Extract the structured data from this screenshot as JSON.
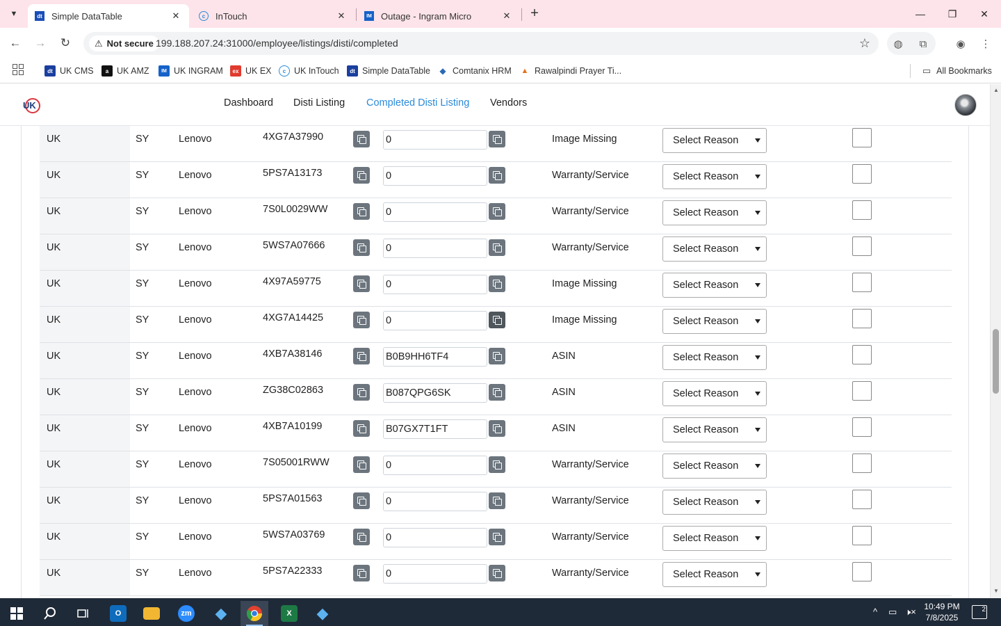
{
  "browser": {
    "tabs": [
      {
        "title": "Simple DataTable",
        "favicon": "dt-icon",
        "favicon_text": "dt",
        "color": "#1a4db8"
      },
      {
        "title": "InTouch",
        "favicon": "intouch-icon",
        "favicon_text": "c",
        "color": "#2a8ad8"
      },
      {
        "title": "Outage - Ingram Micro",
        "favicon": "ingram-icon",
        "favicon_text": "IM",
        "color": "#1562c9"
      }
    ],
    "new_tab": "+",
    "security_label": "Not secure",
    "url": "199.188.207.24:31000/employee/listings/disti/completed",
    "bookmarks": [
      {
        "label": "UK CMS",
        "icon_text": "dt",
        "color": "#1a3f9e"
      },
      {
        "label": "UK AMZ",
        "icon_text": "a",
        "color": "#111111"
      },
      {
        "label": "UK INGRAM",
        "icon_text": "IM",
        "color": "#1562c9"
      },
      {
        "label": "UK EX",
        "icon_text": "ex",
        "color": "#e03b2e"
      },
      {
        "label": "UK InTouch",
        "icon_text": "c",
        "color": "#2a8ad8"
      },
      {
        "label": "Simple DataTable",
        "icon_text": "dt",
        "color": "#1a3f9e"
      },
      {
        "label": "Comtanix HRM",
        "icon_text": "◆",
        "color": "#2c6ab3"
      },
      {
        "label": "Rawalpindi Prayer Ti...",
        "icon_text": "▲",
        "color": "#e5731c"
      }
    ],
    "all_bookmarks": "All Bookmarks"
  },
  "nav": {
    "links": [
      "Dashboard",
      "Disti Listing",
      "Completed Disti Listing",
      "Vendors"
    ],
    "active_index": 2,
    "accent_color": "#2a8ad8"
  },
  "table": {
    "rows": [
      {
        "country": "UK",
        "code": "SY",
        "brand": "Lenovo",
        "sku": "4XG7A37990",
        "value": "0",
        "note": "Image Missing",
        "reason": "Select Reason"
      },
      {
        "country": "UK",
        "code": "SY",
        "brand": "Lenovo",
        "sku": "5PS7A13173",
        "value": "0",
        "note": "Warranty/Service",
        "reason": "Select Reason"
      },
      {
        "country": "UK",
        "code": "SY",
        "brand": "Lenovo",
        "sku": "7S0L0029WW",
        "value": "0",
        "note": "Warranty/Service",
        "reason": "Select Reason"
      },
      {
        "country": "UK",
        "code": "SY",
        "brand": "Lenovo",
        "sku": "5WS7A07666",
        "value": "0",
        "note": "Warranty/Service",
        "reason": "Select Reason"
      },
      {
        "country": "UK",
        "code": "SY",
        "brand": "Lenovo",
        "sku": "4X97A59775",
        "value": "0",
        "note": "Image Missing",
        "reason": "Select Reason"
      },
      {
        "country": "UK",
        "code": "SY",
        "brand": "Lenovo",
        "sku": "4XG7A14425",
        "value": "0",
        "note": "Image Missing",
        "reason": "Select Reason"
      },
      {
        "country": "UK",
        "code": "SY",
        "brand": "Lenovo",
        "sku": "4XB7A38146",
        "value": "B0B9HH6TF4",
        "note": "ASIN",
        "reason": "Select Reason"
      },
      {
        "country": "UK",
        "code": "SY",
        "brand": "Lenovo",
        "sku": "ZG38C02863",
        "value": "B087QPG6SK",
        "note": "ASIN",
        "reason": "Select Reason"
      },
      {
        "country": "UK",
        "code": "SY",
        "brand": "Lenovo",
        "sku": "4XB7A10199",
        "value": "B07GX7T1FT",
        "note": "ASIN",
        "reason": "Select Reason"
      },
      {
        "country": "UK",
        "code": "SY",
        "brand": "Lenovo",
        "sku": "7S05001RWW",
        "value": "0",
        "note": "Warranty/Service",
        "reason": "Select Reason"
      },
      {
        "country": "UK",
        "code": "SY",
        "brand": "Lenovo",
        "sku": "5PS7A01563",
        "value": "0",
        "note": "Warranty/Service",
        "reason": "Select Reason"
      },
      {
        "country": "UK",
        "code": "SY",
        "brand": "Lenovo",
        "sku": "5WS7A03769",
        "value": "0",
        "note": "Warranty/Service",
        "reason": "Select Reason"
      },
      {
        "country": "UK",
        "code": "SY",
        "brand": "Lenovo",
        "sku": "5PS7A22333",
        "value": "0",
        "note": "Warranty/Service",
        "reason": "Select Reason"
      }
    ]
  },
  "taskbar": {
    "apps": [
      {
        "name": "start-icon"
      },
      {
        "name": "search-icon"
      },
      {
        "name": "task-view-icon"
      },
      {
        "name": "outlook-icon",
        "text": "O",
        "color": "#0f6cbd"
      },
      {
        "name": "file-explorer-icon",
        "text": "",
        "color": "#f2b632"
      },
      {
        "name": "zoom-icon",
        "text": "zm",
        "color": "#2d8cff"
      },
      {
        "name": "app-diamond-icon",
        "text": "◆",
        "color": "#3b8fd6"
      },
      {
        "name": "chrome-icon",
        "text": "",
        "color": "#e2412f"
      },
      {
        "name": "excel-icon",
        "text": "X",
        "color": "#1d7a45"
      },
      {
        "name": "app-diamond-icon-2",
        "text": "◆",
        "color": "#3b8fd6"
      }
    ],
    "time": "10:49 PM",
    "date": "7/8/2025",
    "notifications": "2"
  }
}
